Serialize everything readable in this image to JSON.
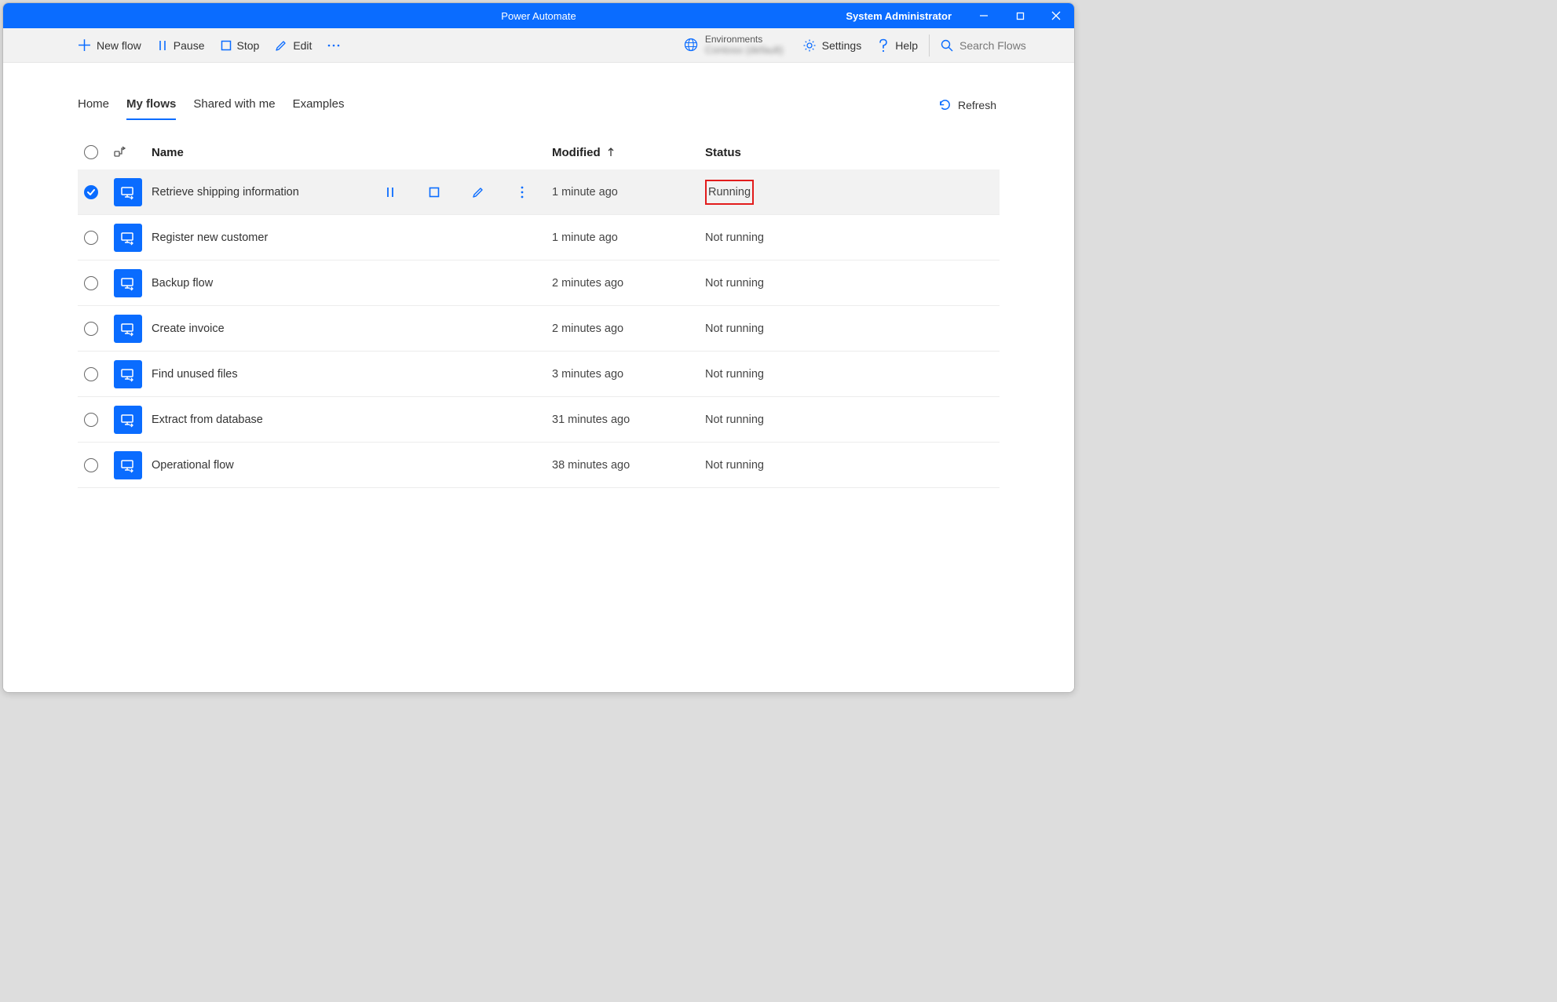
{
  "titlebar": {
    "title": "Power Automate",
    "user": "System Administrator"
  },
  "toolbar": {
    "new_flow": "New flow",
    "pause": "Pause",
    "stop": "Stop",
    "edit": "Edit",
    "env_label": "Environments",
    "env_value": "Contoso (default)",
    "settings": "Settings",
    "help": "Help",
    "search_placeholder": "Search Flows"
  },
  "tabs": {
    "home": "Home",
    "my_flows": "My flows",
    "shared": "Shared with me",
    "examples": "Examples",
    "active": "my_flows"
  },
  "refresh": "Refresh",
  "columns": {
    "name": "Name",
    "modified": "Modified",
    "status": "Status"
  },
  "flows": [
    {
      "name": "Retrieve shipping information",
      "modified": "1 minute ago",
      "status": "Running",
      "selected": true,
      "hovered": true,
      "status_highlight": true
    },
    {
      "name": "Register new customer",
      "modified": "1 minute ago",
      "status": "Not running"
    },
    {
      "name": "Backup flow",
      "modified": "2 minutes ago",
      "status": "Not running"
    },
    {
      "name": "Create invoice",
      "modified": "2 minutes ago",
      "status": "Not running"
    },
    {
      "name": "Find unused files",
      "modified": "3 minutes ago",
      "status": "Not running"
    },
    {
      "name": "Extract from database",
      "modified": "31 minutes ago",
      "status": "Not running"
    },
    {
      "name": "Operational flow",
      "modified": "38 minutes ago",
      "status": "Not running"
    }
  ]
}
